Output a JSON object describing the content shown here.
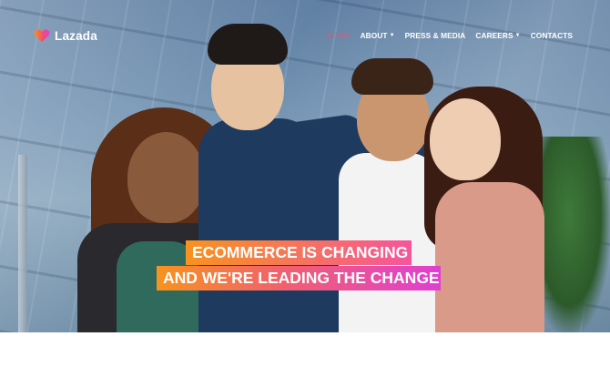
{
  "brand": {
    "name": "Lazada",
    "icon": "heart-logo-icon",
    "logo_colors": [
      "#f7931e",
      "#f0506e",
      "#e03fd2"
    ]
  },
  "nav": {
    "items": [
      {
        "label": "HOME",
        "active": true,
        "has_dropdown": false
      },
      {
        "label": "ABOUT",
        "active": false,
        "has_dropdown": true
      },
      {
        "label": "PRESS & MEDIA",
        "active": false,
        "has_dropdown": false
      },
      {
        "label": "CAREERS",
        "active": false,
        "has_dropdown": true
      },
      {
        "label": "CONTACTS",
        "active": false,
        "has_dropdown": false
      }
    ],
    "active_color": "#f0506e",
    "dropdown_icon": "caret-down-icon"
  },
  "hero": {
    "headline_line1": "ECOMMERCE IS CHANGING",
    "headline_line2": "AND WE'RE LEADING THE CHANGE",
    "highlight_gradient": [
      "#f7931e",
      "#f5559c",
      "#e03fd2"
    ]
  }
}
